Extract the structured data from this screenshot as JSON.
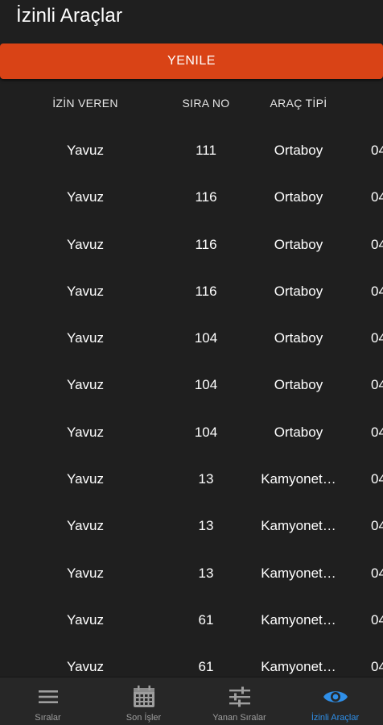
{
  "app": {
    "title": "İzinli Araçlar",
    "refresh_label": "YENILE"
  },
  "colors": {
    "accent_button": "#d94316",
    "active_nav": "#2f8fe8",
    "inactive_nav": "#9e9e9e",
    "background": "#1f1f1f"
  },
  "table": {
    "headers": [
      "İZİN VEREN",
      "SIRA NO",
      "ARAÇ TİPİ",
      ""
    ],
    "rows": [
      [
        "Yavuz",
        "111",
        "Ortaboy",
        "04"
      ],
      [
        "Yavuz",
        "116",
        "Ortaboy",
        "04"
      ],
      [
        "Yavuz",
        "116",
        "Ortaboy",
        "04"
      ],
      [
        "Yavuz",
        "116",
        "Ortaboy",
        "04"
      ],
      [
        "Yavuz",
        "104",
        "Ortaboy",
        "04"
      ],
      [
        "Yavuz",
        "104",
        "Ortaboy",
        "04"
      ],
      [
        "Yavuz",
        "104",
        "Ortaboy",
        "04"
      ],
      [
        "Yavuz",
        "13",
        "Kamyonet…",
        "04"
      ],
      [
        "Yavuz",
        "13",
        "Kamyonet…",
        "04"
      ],
      [
        "Yavuz",
        "13",
        "Kamyonet…",
        "04"
      ],
      [
        "Yavuz",
        "61",
        "Kamyonet…",
        "04"
      ],
      [
        "Yavuz",
        "61",
        "Kamyonet…",
        "04"
      ]
    ]
  },
  "bottom_nav": {
    "items": [
      {
        "label": "Sıralar",
        "icon": "menu-icon",
        "active": false
      },
      {
        "label": "Son İşler",
        "icon": "calendar-icon",
        "active": false
      },
      {
        "label": "Yanan Sıralar",
        "icon": "sliders-icon",
        "active": false
      },
      {
        "label": "İzinli Araçlar",
        "icon": "eye-icon",
        "active": true
      }
    ]
  }
}
